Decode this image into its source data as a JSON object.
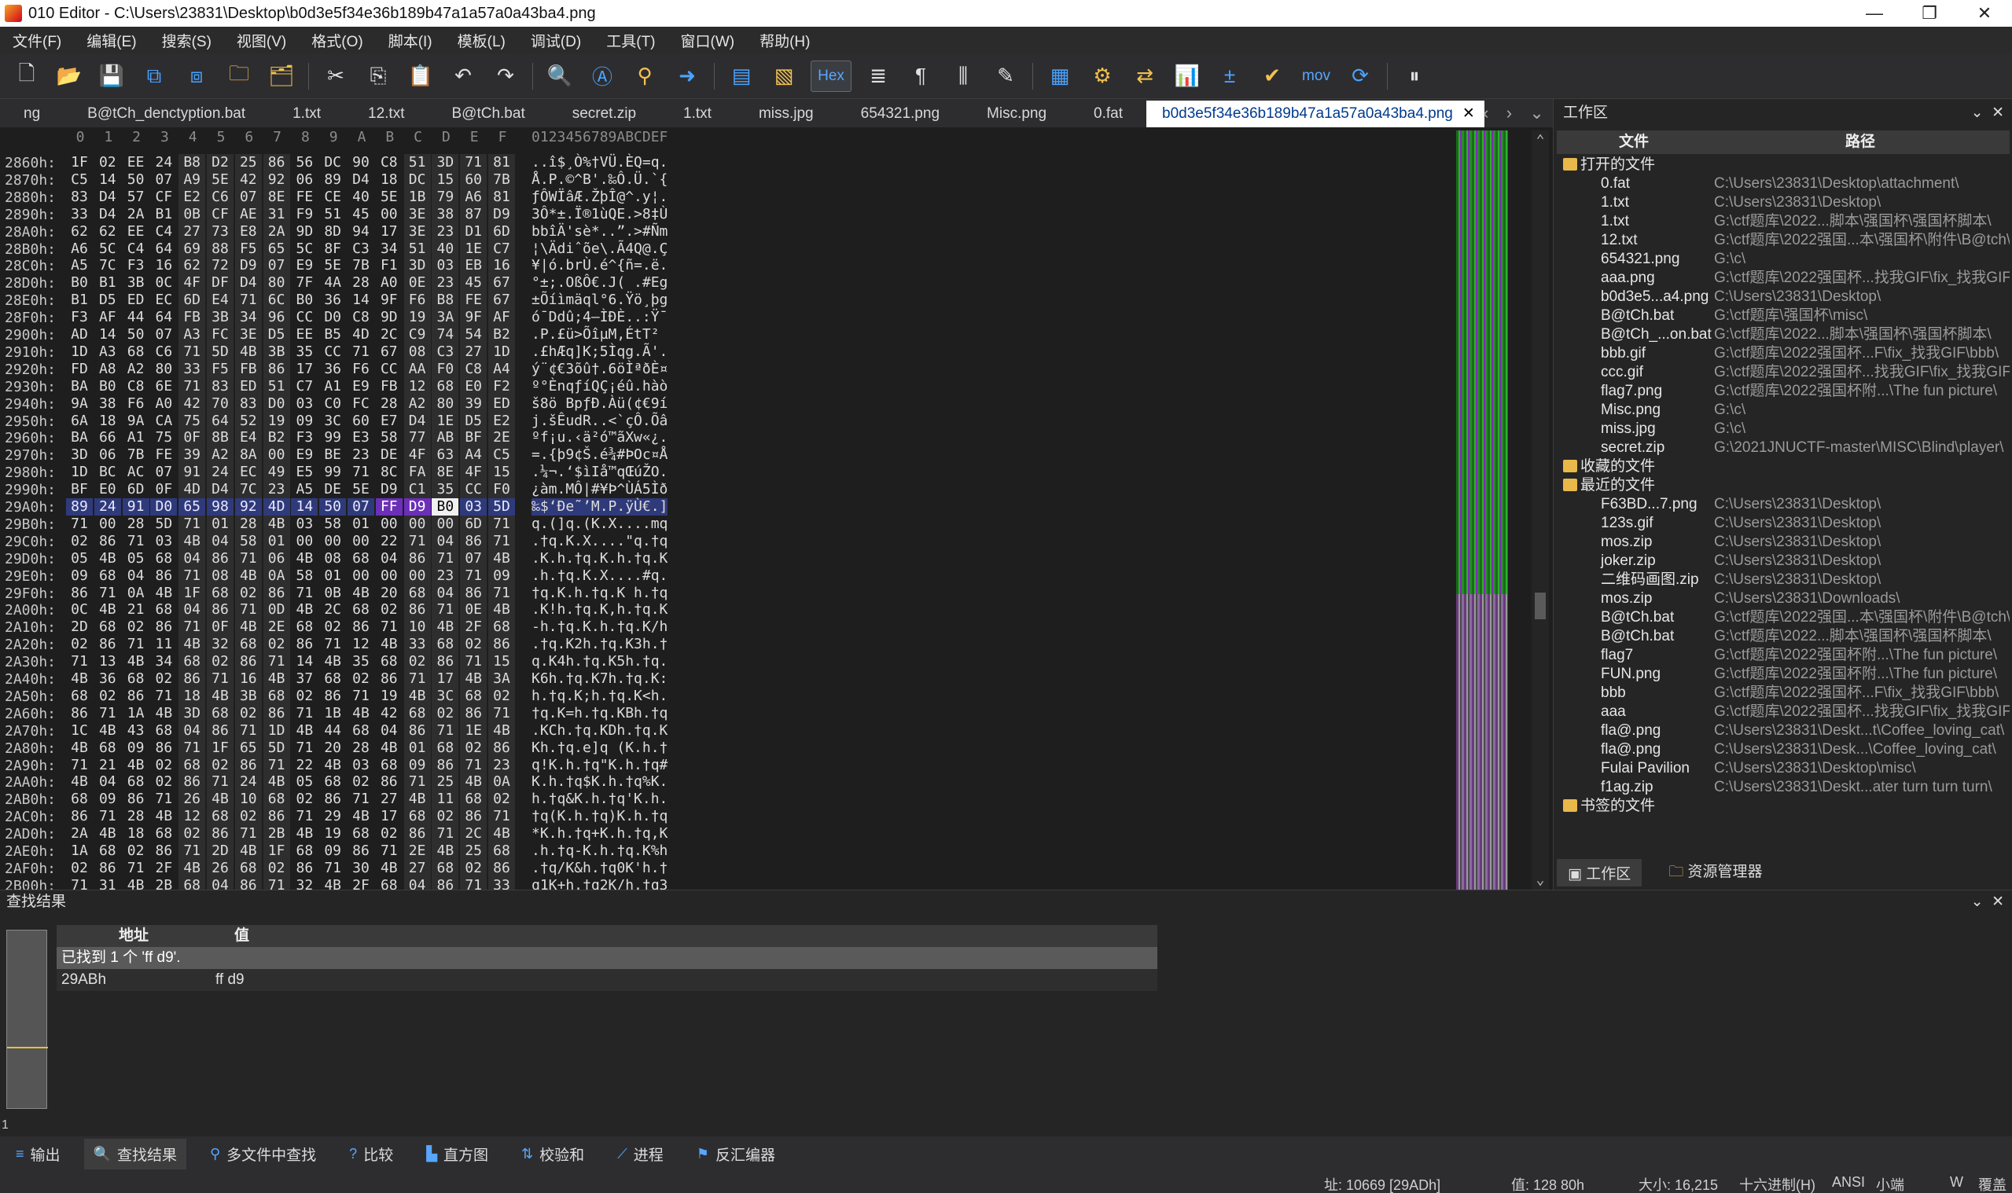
{
  "window": {
    "title": "010 Editor - C:\\Users\\23831\\Desktop\\b0d3e5f34e36b189b47a1a57a0a43ba4.png",
    "minimize": "—",
    "maximize": "❐",
    "close": "✕"
  },
  "menu": [
    "文件(F)",
    "编辑(E)",
    "搜索(S)",
    "视图(V)",
    "格式(O)",
    "脚本(I)",
    "模板(L)",
    "调试(D)",
    "工具(T)",
    "窗口(W)",
    "帮助(H)"
  ],
  "toolbar": {
    "hex_label": "Hex",
    "mov_label": "mov"
  },
  "tabs": [
    "ng",
    "B@tCh_denctyption.bat",
    "1.txt",
    "12.txt",
    "B@tCh.bat",
    "secret.zip",
    "1.txt",
    "miss.jpg",
    "654321.png",
    "Misc.png",
    "0.fat"
  ],
  "active_tab": "b0d3e5f34e36b189b47a1a57a0a43ba4.png",
  "hex": {
    "col_headers": [
      "0",
      "1",
      "2",
      "3",
      "4",
      "5",
      "6",
      "7",
      "8",
      "9",
      "A",
      "B",
      "C",
      "D",
      "E",
      "F"
    ],
    "ascii_header": "0123456789ABCDEF",
    "rows": [
      {
        "a": "2860h:",
        "b": [
          "1F",
          "02",
          "EE",
          "24",
          "B8",
          "D2",
          "25",
          "86",
          "56",
          "DC",
          "90",
          "C8",
          "51",
          "3D",
          "71",
          "81"
        ],
        "t": "..î$¸Ò%†VÜ.ÈQ=q."
      },
      {
        "a": "2870h:",
        "b": [
          "C5",
          "14",
          "50",
          "07",
          "A9",
          "5E",
          "42",
          "92",
          "06",
          "89",
          "D4",
          "18",
          "DC",
          "15",
          "60",
          "7B"
        ],
        "t": "Å.P.©^B'.‰Ô.Ü.`{"
      },
      {
        "a": "2880h:",
        "b": [
          "83",
          "D4",
          "57",
          "CF",
          "E2",
          "C6",
          "07",
          "8E",
          "FE",
          "CE",
          "40",
          "5E",
          "1B",
          "79",
          "A6",
          "81"
        ],
        "t": "ƒÔWÏâÆ.ŽþÎ@^.y¦."
      },
      {
        "a": "2890h:",
        "b": [
          "33",
          "D4",
          "2A",
          "B1",
          "0B",
          "CF",
          "AE",
          "31",
          "F9",
          "51",
          "45",
          "00",
          "3E",
          "38",
          "87",
          "D9"
        ],
        "t": "3Ô*±.Ï®1ùQE.>8‡Ù"
      },
      {
        "a": "28A0h:",
        "b": [
          "62",
          "62",
          "EE",
          "C4",
          "27",
          "73",
          "E8",
          "2A",
          "9D",
          "8D",
          "94",
          "17",
          "3E",
          "23",
          "D1",
          "6D"
        ],
        "t": "bbîÄ'sè*..”.>#Ñm"
      },
      {
        "a": "28B0h:",
        "b": [
          "A6",
          "5C",
          "C4",
          "64",
          "69",
          "88",
          "F5",
          "65",
          "5C",
          "8F",
          "C3",
          "34",
          "51",
          "40",
          "1E",
          "C7"
        ],
        "t": "¦\\Ädiˆõe\\.Ã4Q@.Ç"
      },
      {
        "a": "28C0h:",
        "b": [
          "A5",
          "7C",
          "F3",
          "16",
          "62",
          "72",
          "D9",
          "07",
          "E9",
          "5E",
          "7B",
          "F1",
          "3D",
          "03",
          "EB",
          "16"
        ],
        "t": "¥|ó.brÙ.é^{ñ=.ë."
      },
      {
        "a": "28D0h:",
        "b": [
          "B0",
          "B1",
          "3B",
          "0C",
          "4F",
          "DF",
          "D4",
          "80",
          "7F",
          "4A",
          "28",
          "A0",
          "0E",
          "23",
          "45",
          "67"
        ],
        "t": "°±;.OßÔ€.J( .#Eg"
      },
      {
        "a": "28E0h:",
        "b": [
          "B1",
          "D5",
          "ED",
          "EC",
          "6D",
          "E4",
          "71",
          "6C",
          "B0",
          "36",
          "14",
          "9F",
          "F6",
          "B8",
          "FE",
          "67"
        ],
        "t": "±Õíìmäql°6.Ÿö¸þg"
      },
      {
        "a": "28F0h:",
        "b": [
          "F3",
          "AF",
          "44",
          "64",
          "FB",
          "3B",
          "34",
          "96",
          "CC",
          "D0",
          "C8",
          "9D",
          "19",
          "3A",
          "9F",
          "AF"
        ],
        "t": "ó¯Ddû;4–ÌÐÈ..:Ÿ¯"
      },
      {
        "a": "2900h:",
        "b": [
          "AD",
          "14",
          "50",
          "07",
          "A3",
          "FC",
          "3E",
          "D5",
          "EE",
          "B5",
          "4D",
          "2C",
          "C9",
          "74",
          "54",
          "B2"
        ],
        "t": "­.P.£ü>ÕîµM,ÉtT²"
      },
      {
        "a": "2910h:",
        "b": [
          "1D",
          "A3",
          "68",
          "C6",
          "71",
          "5D",
          "4B",
          "3B",
          "35",
          "CC",
          "71",
          "67",
          "08",
          "C3",
          "27",
          "1D"
        ],
        "t": ".£hÆq]K;5Ìqg.Ã'."
      },
      {
        "a": "2920h:",
        "b": [
          "FD",
          "A8",
          "A2",
          "80",
          "33",
          "F5",
          "FB",
          "86",
          "17",
          "36",
          "F6",
          "CC",
          "AA",
          "F0",
          "C8",
          "A4"
        ],
        "t": "ý¨¢€3õû†.6öÌªðÈ¤"
      },
      {
        "a": "2930h:",
        "b": [
          "BA",
          "B0",
          "C8",
          "6E",
          "71",
          "83",
          "ED",
          "51",
          "C7",
          "A1",
          "E9",
          "FB",
          "12",
          "68",
          "E0",
          "F2"
        ],
        "t": "º°ÈnqƒíQÇ¡éû.hàò"
      },
      {
        "a": "2940h:",
        "b": [
          "9A",
          "38",
          "F6",
          "A0",
          "42",
          "70",
          "83",
          "D0",
          "03",
          "C0",
          "FC",
          "28",
          "A2",
          "80",
          "39",
          "ED"
        ],
        "t": "š8ö BpƒÐ.Àü(¢€9í"
      },
      {
        "a": "2950h:",
        "b": [
          "6A",
          "18",
          "9A",
          "CA",
          "75",
          "64",
          "52",
          "19",
          "09",
          "3C",
          "60",
          "E7",
          "D4",
          "1E",
          "D5",
          "E2"
        ],
        "t": "j.šÊudR..<`çÔ.Õâ"
      },
      {
        "a": "2960h:",
        "b": [
          "BA",
          "66",
          "A1",
          "75",
          "0F",
          "8B",
          "E4",
          "B2",
          "F3",
          "99",
          "E3",
          "58",
          "77",
          "AB",
          "BF",
          "2E"
        ],
        "t": "ºf¡u.‹ä²ó™ãXw«¿."
      },
      {
        "a": "2970h:",
        "b": [
          "3D",
          "06",
          "7B",
          "FE",
          "39",
          "A2",
          "8A",
          "00",
          "E9",
          "BE",
          "23",
          "DE",
          "4F",
          "63",
          "A4",
          "C5"
        ],
        "t": "=.{þ9¢Š.é¾#ÞOc¤Å"
      },
      {
        "a": "2980h:",
        "b": [
          "1D",
          "BC",
          "AC",
          "07",
          "91",
          "24",
          "EC",
          "49",
          "E5",
          "99",
          "71",
          "8C",
          "FA",
          "8E",
          "4F",
          "15"
        ],
        "t": ".¼¬.‘$ìIå™qŒúŽO."
      },
      {
        "a": "2990h:",
        "b": [
          "BF",
          "E0",
          "6D",
          "0F",
          "4D",
          "D4",
          "7C",
          "23",
          "A5",
          "DE",
          "5E",
          "D9",
          "C1",
          "35",
          "CC",
          "F0"
        ],
        "t": "¿àm.MÔ|#¥Þ^ÙÁ5Ìð"
      },
      {
        "a": "29A0h:",
        "b": [
          "89",
          "24",
          "91",
          "D0",
          "65",
          "98",
          "92",
          "4D",
          "14",
          "50",
          "07",
          "FF",
          "D9",
          "B0",
          "03",
          "5D"
        ],
        "t": "‰$‘Ðe˜’M.P.ÿÙ€.]",
        "hl": true
      },
      {
        "a": "29B0h:",
        "b": [
          "71",
          "00",
          "28",
          "5D",
          "71",
          "01",
          "28",
          "4B",
          "03",
          "58",
          "01",
          "00",
          "00",
          "00",
          "6D",
          "71"
        ],
        "t": "q.(]q.(K.X....mq"
      },
      {
        "a": "29C0h:",
        "b": [
          "02",
          "86",
          "71",
          "03",
          "4B",
          "04",
          "58",
          "01",
          "00",
          "00",
          "00",
          "22",
          "71",
          "04",
          "86",
          "71"
        ],
        "t": ".†q.K.X....\"q.†q"
      },
      {
        "a": "29D0h:",
        "b": [
          "05",
          "4B",
          "05",
          "68",
          "04",
          "86",
          "71",
          "06",
          "4B",
          "08",
          "68",
          "04",
          "86",
          "71",
          "07",
          "4B"
        ],
        "t": ".K.h.†q.K.h.†q.K"
      },
      {
        "a": "29E0h:",
        "b": [
          "09",
          "68",
          "04",
          "86",
          "71",
          "08",
          "4B",
          "0A",
          "58",
          "01",
          "00",
          "00",
          "00",
          "23",
          "71",
          "09"
        ],
        "t": ".h.†q.K.X....#q."
      },
      {
        "a": "29F0h:",
        "b": [
          "86",
          "71",
          "0A",
          "4B",
          "1F",
          "68",
          "02",
          "86",
          "71",
          "0B",
          "4B",
          "20",
          "68",
          "04",
          "86",
          "71"
        ],
        "t": "†q.K.h.†q.K h.†q"
      },
      {
        "a": "2A00h:",
        "b": [
          "0C",
          "4B",
          "21",
          "68",
          "04",
          "86",
          "71",
          "0D",
          "4B",
          "2C",
          "68",
          "02",
          "86",
          "71",
          "0E",
          "4B"
        ],
        "t": ".K!h.†q.K,h.†q.K"
      },
      {
        "a": "2A10h:",
        "b": [
          "2D",
          "68",
          "02",
          "86",
          "71",
          "0F",
          "4B",
          "2E",
          "68",
          "02",
          "86",
          "71",
          "10",
          "4B",
          "2F",
          "68"
        ],
        "t": "-h.†q.K.h.†q.K/h"
      },
      {
        "a": "2A20h:",
        "b": [
          "02",
          "86",
          "71",
          "11",
          "4B",
          "32",
          "68",
          "02",
          "86",
          "71",
          "12",
          "4B",
          "33",
          "68",
          "02",
          "86"
        ],
        "t": ".†q.K2h.†q.K3h.†"
      },
      {
        "a": "2A30h:",
        "b": [
          "71",
          "13",
          "4B",
          "34",
          "68",
          "02",
          "86",
          "71",
          "14",
          "4B",
          "35",
          "68",
          "02",
          "86",
          "71",
          "15"
        ],
        "t": "q.K4h.†q.K5h.†q."
      },
      {
        "a": "2A40h:",
        "b": [
          "4B",
          "36",
          "68",
          "02",
          "86",
          "71",
          "16",
          "4B",
          "37",
          "68",
          "02",
          "86",
          "71",
          "17",
          "4B",
          "3A"
        ],
        "t": "K6h.†q.K7h.†q.K:"
      },
      {
        "a": "2A50h:",
        "b": [
          "68",
          "02",
          "86",
          "71",
          "18",
          "4B",
          "3B",
          "68",
          "02",
          "86",
          "71",
          "19",
          "4B",
          "3C",
          "68",
          "02"
        ],
        "t": "h.†q.K;h.†q.K<h."
      },
      {
        "a": "2A60h:",
        "b": [
          "86",
          "71",
          "1A",
          "4B",
          "3D",
          "68",
          "02",
          "86",
          "71",
          "1B",
          "4B",
          "42",
          "68",
          "02",
          "86",
          "71"
        ],
        "t": "†q.K=h.†q.KBh.†q"
      },
      {
        "a": "2A70h:",
        "b": [
          "1C",
          "4B",
          "43",
          "68",
          "04",
          "86",
          "71",
          "1D",
          "4B",
          "44",
          "68",
          "04",
          "86",
          "71",
          "1E",
          "4B"
        ],
        "t": ".KCh.†q.KDh.†q.K"
      },
      {
        "a": "2A80h:",
        "b": [
          "4B",
          "68",
          "09",
          "86",
          "71",
          "1F",
          "65",
          "5D",
          "71",
          "20",
          "28",
          "4B",
          "01",
          "68",
          "02",
          "86"
        ],
        "t": "Kh.†q.e]q (K.h.†"
      },
      {
        "a": "2A90h:",
        "b": [
          "71",
          "21",
          "4B",
          "02",
          "68",
          "02",
          "86",
          "71",
          "22",
          "4B",
          "03",
          "68",
          "09",
          "86",
          "71",
          "23"
        ],
        "t": "q!K.h.†q\"K.h.†q#"
      },
      {
        "a": "2AA0h:",
        "b": [
          "4B",
          "04",
          "68",
          "02",
          "86",
          "71",
          "24",
          "4B",
          "05",
          "68",
          "02",
          "86",
          "71",
          "25",
          "4B",
          "0A"
        ],
        "t": "K.h.†q$K.h.†q%K."
      },
      {
        "a": "2AB0h:",
        "b": [
          "68",
          "09",
          "86",
          "71",
          "26",
          "4B",
          "10",
          "68",
          "02",
          "86",
          "71",
          "27",
          "4B",
          "11",
          "68",
          "02"
        ],
        "t": "h.†q&K.h.†q'K.h."
      },
      {
        "a": "2AC0h:",
        "b": [
          "86",
          "71",
          "28",
          "4B",
          "12",
          "68",
          "02",
          "86",
          "71",
          "29",
          "4B",
          "17",
          "68",
          "02",
          "86",
          "71"
        ],
        "t": "†q(K.h.†q)K.h.†q"
      },
      {
        "a": "2AD0h:",
        "b": [
          "2A",
          "4B",
          "18",
          "68",
          "02",
          "86",
          "71",
          "2B",
          "4B",
          "19",
          "68",
          "02",
          "86",
          "71",
          "2C",
          "4B"
        ],
        "t": "*K.h.†q+K.h.†q,K"
      },
      {
        "a": "2AE0h:",
        "b": [
          "1A",
          "68",
          "02",
          "86",
          "71",
          "2D",
          "4B",
          "1F",
          "68",
          "09",
          "86",
          "71",
          "2E",
          "4B",
          "25",
          "68"
        ],
        "t": ".h.†q-K.h.†q.K%h"
      },
      {
        "a": "2AF0h:",
        "b": [
          "02",
          "86",
          "71",
          "2F",
          "4B",
          "26",
          "68",
          "02",
          "86",
          "71",
          "30",
          "4B",
          "27",
          "68",
          "02",
          "86"
        ],
        "t": ".†q/K&h.†q0K'h.†"
      },
      {
        "a": "2B00h:",
        "b": [
          "71",
          "31",
          "4B",
          "2B",
          "68",
          "04",
          "86",
          "71",
          "32",
          "4B",
          "2F",
          "68",
          "04",
          "86",
          "71",
          "33"
        ],
        "t": "q1K+h.†q2K/h.†q3"
      }
    ]
  },
  "workspace": {
    "title": "工作区",
    "col_file": "文件",
    "col_path": "路径",
    "group_open": "打开的文件",
    "open_files": [
      {
        "name": "0.fat",
        "path": "C:\\Users\\23831\\Desktop\\attachment\\"
      },
      {
        "name": "1.txt",
        "path": "C:\\Users\\23831\\Desktop\\"
      },
      {
        "name": "1.txt",
        "path": "G:\\ctf题库\\2022...脚本\\强国杯\\强国杯脚本\\"
      },
      {
        "name": "12.txt",
        "path": "G:\\ctf题库\\2022强国...本\\强国杯\\附件\\B@tch\\"
      },
      {
        "name": "654321.png",
        "path": "G:\\c\\"
      },
      {
        "name": "aaa.png",
        "path": "G:\\ctf题库\\2022强国杯...找我GIF\\fix_找我GIF\\"
      },
      {
        "name": "b0d3e5...a4.png",
        "path": "C:\\Users\\23831\\Desktop\\"
      },
      {
        "name": "B@tCh.bat",
        "path": "G:\\ctf题库\\强国杯\\misc\\"
      },
      {
        "name": "B@tCh_...on.bat",
        "path": "G:\\ctf题库\\2022...脚本\\强国杯\\强国杯脚本\\"
      },
      {
        "name": "bbb.gif",
        "path": "G:\\ctf题库\\2022强国杯...F\\fix_找我GIF\\bbb\\"
      },
      {
        "name": "ccc.gif",
        "path": "G:\\ctf题库\\2022强国杯...找我GIF\\fix_找我GIF\\"
      },
      {
        "name": "flag7.png",
        "path": "G:\\ctf题库\\2022强国杯附...\\The fun picture\\"
      },
      {
        "name": "Misc.png",
        "path": "G:\\c\\"
      },
      {
        "name": "miss.jpg",
        "path": "G:\\c\\"
      },
      {
        "name": "secret.zip",
        "path": "G:\\2021JNUCTF-master\\MISC\\Blind\\player\\"
      }
    ],
    "group_fav": "收藏的文件",
    "group_recent": "最近的文件",
    "recent_files": [
      {
        "name": "F63BD...7.png",
        "path": "C:\\Users\\23831\\Desktop\\"
      },
      {
        "name": "123s.gif",
        "path": "C:\\Users\\23831\\Desktop\\"
      },
      {
        "name": "mos.zip",
        "path": "C:\\Users\\23831\\Desktop\\"
      },
      {
        "name": "joker.zip",
        "path": "C:\\Users\\23831\\Desktop\\"
      },
      {
        "name": "二维码画图.zip",
        "path": "C:\\Users\\23831\\Desktop\\"
      },
      {
        "name": "mos.zip",
        "path": "C:\\Users\\23831\\Downloads\\"
      },
      {
        "name": "B@tCh.bat",
        "path": "G:\\ctf题库\\2022强国...本\\强国杯\\附件\\B@tch\\"
      },
      {
        "name": "B@tCh.bat",
        "path": "G:\\ctf题库\\2022...脚本\\强国杯\\强国杯脚本\\"
      },
      {
        "name": "flag7",
        "path": "G:\\ctf题库\\2022强国杯附...\\The fun picture\\"
      },
      {
        "name": "FUN.png",
        "path": "G:\\ctf题库\\2022强国杯附...\\The fun picture\\"
      },
      {
        "name": "bbb",
        "path": "G:\\ctf题库\\2022强国杯...F\\fix_找我GIF\\bbb\\"
      },
      {
        "name": "aaa",
        "path": "G:\\ctf题库\\2022强国杯...找我GIF\\fix_找我GIF\\"
      },
      {
        "name": "fla@.png",
        "path": "C:\\Users\\23831\\Deskt...t\\Coffee_loving_cat\\"
      },
      {
        "name": "fla@.png",
        "path": "C:\\Users\\23831\\Desk...\\Coffee_loving_cat\\"
      },
      {
        "name": "Fulai Pavilion",
        "path": "C:\\Users\\23831\\Desktop\\misc\\"
      },
      {
        "name": "f1ag.zip",
        "path": "C:\\Users\\23831\\Deskt...ater turn turn turn\\"
      }
    ],
    "group_bookmark": "书签的文件",
    "tab_workspace": "工作区",
    "tab_explorer": "资源管理器"
  },
  "find": {
    "title": "查找结果",
    "col_addr": "地址",
    "col_value": "值",
    "summary": "已找到 1 个 'ff d9'.",
    "result_addr": "29ABh",
    "result_value": "ff d9",
    "side_count": "1"
  },
  "dock_tabs": [
    "输出",
    "查找结果",
    "多文件中查找",
    "比较",
    "直方图",
    "校验和",
    "进程",
    "反汇编器"
  ],
  "status": {
    "address": "址: 10669 [29ADh]",
    "value": "值: 128 80h",
    "size": "大小: 16,215",
    "mode": "十六进制(H)",
    "encoding": "ANSI",
    "endian": "小端",
    "write": "W",
    "overwrite": "覆盖"
  }
}
